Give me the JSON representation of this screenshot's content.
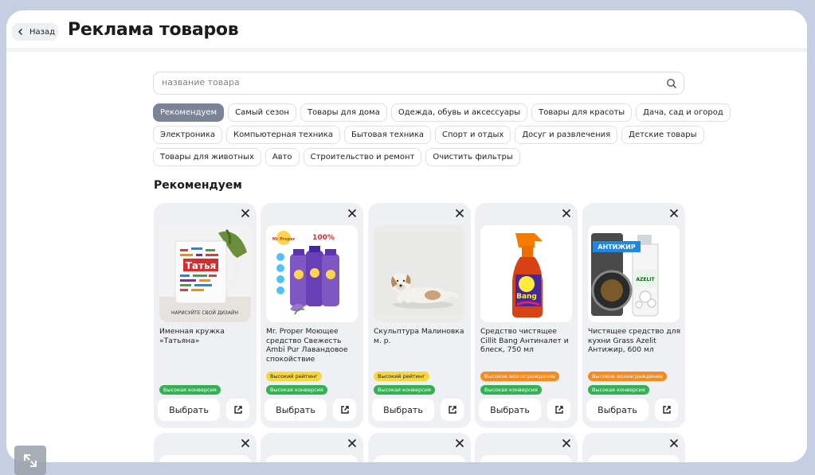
{
  "header": {
    "back_label": "Назад",
    "title": "Реклама товаров"
  },
  "search": {
    "placeholder": "название товара",
    "value": ""
  },
  "filters": {
    "row1": [
      "Рекомендуем",
      "Самый сезон",
      "Товары для дома",
      "Одежда, обувь и аксессуары",
      "Товары для красоты",
      "Дача, сад и огород"
    ],
    "row2": [
      "Электроника",
      "Компьютерная техника",
      "Бытовая техника",
      "Спорт и отдых",
      "Досуг и развлечения",
      "Детские товары"
    ],
    "row3": [
      "Товары для животных",
      "Авто",
      "Строительство и ремонт",
      "Очистить фильтры"
    ],
    "active": "Рекомендуем"
  },
  "section": {
    "title": "Рекомендуем"
  },
  "products": [
    {
      "name": "Именная кружка «Татьяна»",
      "image_icon": "mug-image",
      "mug_name": "Татья",
      "mug_caption": "НАРИСУЙТЕ СВОЙ ДИЗАЙН",
      "badges": [
        {
          "type": "conv",
          "label": "Высокая конверсия"
        }
      ],
      "choose_label": "Выбрать"
    },
    {
      "name": "Mr. Proper Моющее средство Свежесть Ambi Pur Лавандовое спокойствие",
      "image_icon": "detergent-bottles-image",
      "brand_text": "Mr Proper",
      "badges": [
        {
          "type": "rating",
          "label": "Высокий рейтинг"
        },
        {
          "type": "conv",
          "label": "Высокая конверсия"
        }
      ],
      "choose_label": "Выбрать"
    },
    {
      "name": "Скульптура Малиновка м. р.",
      "image_icon": "dog-figurine-image",
      "badges": [
        {
          "type": "rating",
          "label": "Высокий рейтинг"
        },
        {
          "type": "conv",
          "label": "Высокая конверсия"
        }
      ],
      "choose_label": "Выбрать"
    },
    {
      "name": "Средство чистящее Cillit Bang Антиналет и блеск, 750 мл",
      "image_icon": "spray-bottle-image",
      "brand_text": "Bang",
      "badges": [
        {
          "type": "reward",
          "label": "Высокое вознаграждение"
        },
        {
          "type": "conv",
          "label": "Высокая конверсия"
        }
      ],
      "choose_label": "Выбрать"
    },
    {
      "name": "Чистящее средство для кухни Grass Azelit Антижир, 600 мл",
      "image_icon": "azelit-bottle-image",
      "brand_text": "АНТИЖИР",
      "brand_text2": "AZELIT",
      "badges": [
        {
          "type": "reward",
          "label": "Высокое вознаграждение"
        },
        {
          "type": "conv",
          "label": "Высокая конверсия"
        }
      ],
      "choose_label": "Выбрать"
    }
  ],
  "colors": {
    "background": "#c5cee3",
    "card": "#eef0f3",
    "active_chip": "#7c8397",
    "conversion_badge": "#35b054",
    "rating_badge": "#f7d63e",
    "reward_badge": "#f58a1f"
  }
}
